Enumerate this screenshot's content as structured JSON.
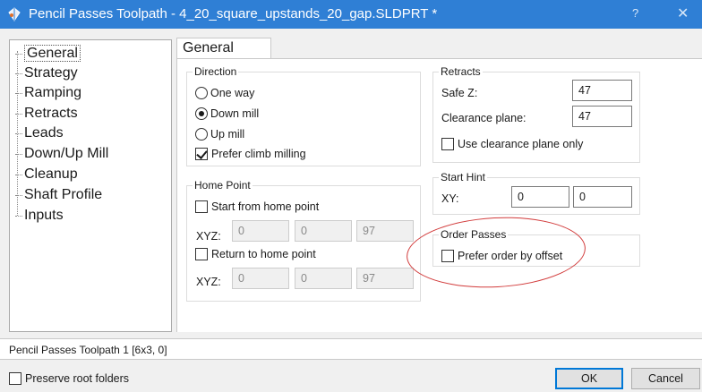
{
  "window": {
    "title": "Pencil Passes Toolpath - 4_20_square_upstands_20_gap.SLDPRT *",
    "help_glyph": "?",
    "close_glyph": "✕",
    "icon": "toolpath-icon"
  },
  "tree": {
    "items": [
      {
        "label": "General"
      },
      {
        "label": "Strategy"
      },
      {
        "label": "Ramping"
      },
      {
        "label": "Retracts"
      },
      {
        "label": "Leads"
      },
      {
        "label": "Down/Up Mill"
      },
      {
        "label": "Cleanup"
      },
      {
        "label": "Shaft Profile"
      },
      {
        "label": "Inputs"
      }
    ],
    "selected_index": 0
  },
  "tab": {
    "label": "General"
  },
  "direction": {
    "label": "Direction",
    "one_way": "One way",
    "down_mill": "Down mill",
    "up_mill": "Up mill",
    "selected": "Down mill",
    "prefer_climb": "Prefer climb milling",
    "prefer_climb_checked": true
  },
  "home_point": {
    "label": "Home Point",
    "start_label": "Start from home point",
    "start_checked": false,
    "xyz_label": "XYZ:",
    "start_xyz": [
      "0",
      "0",
      "97"
    ],
    "return_label": "Return to home point",
    "return_checked": false,
    "return_xyz": [
      "0",
      "0",
      "97"
    ]
  },
  "retracts": {
    "label": "Retracts",
    "safe_z_label": "Safe Z:",
    "safe_z": "47",
    "clearance_label": "Clearance plane:",
    "clearance": "47",
    "use_clearance_label": "Use clearance plane only",
    "use_clearance_checked": false
  },
  "start_hint": {
    "label": "Start Hint",
    "xy_label": "XY:",
    "x": "0",
    "y": "0"
  },
  "order_passes": {
    "label": "Order Passes",
    "prefer_offset_label": "Prefer order by offset",
    "prefer_offset_checked": false,
    "highlight_color": "#d23c3c"
  },
  "status": {
    "text": "Pencil Passes Toolpath 1 [6x3, 0]"
  },
  "footer": {
    "preserve_label": "Preserve root folders",
    "preserve_checked": false,
    "ok_label": "OK",
    "cancel_label": "Cancel"
  },
  "colors": {
    "titlebar": "#2f7fd5",
    "accent": "#0078d7"
  }
}
